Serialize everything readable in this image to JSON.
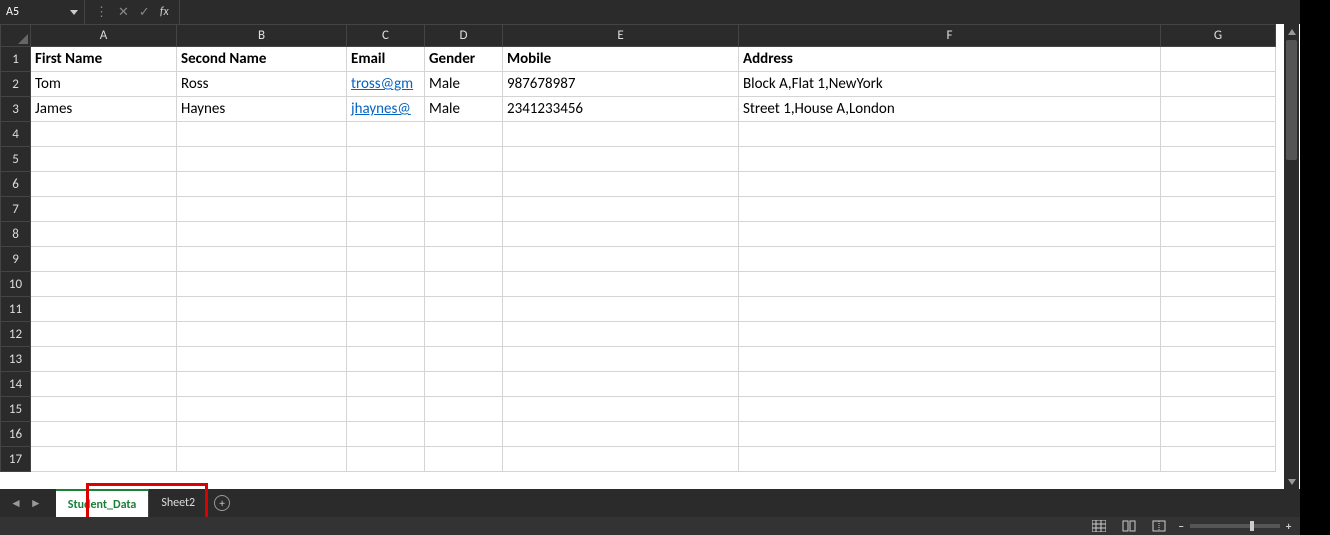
{
  "formula_bar": {
    "cell_ref": "A5",
    "fx_label": "fx",
    "value": ""
  },
  "columns": [
    "A",
    "B",
    "C",
    "D",
    "E",
    "F",
    "G"
  ],
  "header_row": [
    "First Name",
    "Second Name",
    "Email",
    "Gender",
    "Mobile",
    "Address"
  ],
  "data_rows": [
    {
      "first": "Tom",
      "second": "Ross",
      "email": "tross@gm",
      "gender": "Male",
      "mobile": "987678987",
      "address": "Block A,Flat 1,NewYork"
    },
    {
      "first": "James",
      "second": "Haynes",
      "email": "jhaynes@",
      "gender": "Male",
      "mobile": "2341233456",
      "address": "Street 1,House A,London"
    }
  ],
  "total_rows_visible": 17,
  "tabs": [
    {
      "label": "Student_Data",
      "active": true
    },
    {
      "label": "Sheet2",
      "active": false
    }
  ],
  "status_bar": {
    "zoom": "130%"
  }
}
